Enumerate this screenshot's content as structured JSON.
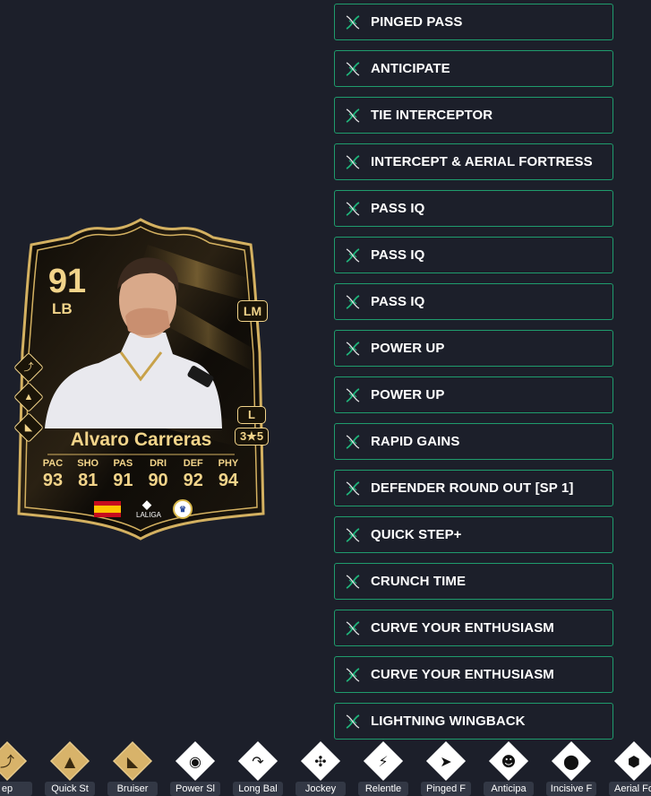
{
  "card": {
    "rating": "91",
    "position": "LB",
    "alt_position": "LM",
    "preferred_foot": "L",
    "skill_weak": "3★5",
    "name": "Alvaro Carreras",
    "stats": [
      {
        "label": "PAC",
        "value": "93"
      },
      {
        "label": "SHO",
        "value": "81"
      },
      {
        "label": "PAS",
        "value": "91"
      },
      {
        "label": "DRI",
        "value": "90"
      },
      {
        "label": "DEF",
        "value": "92"
      },
      {
        "label": "PHY",
        "value": "94"
      }
    ],
    "nation_icon": "spain-flag-icon",
    "league_icon": "laliga-icon",
    "league_label": "LALIGA",
    "club_icon": "real-madrid-crest-icon",
    "colors": {
      "gold": "#f2d48a",
      "card_bg": "#16130d"
    }
  },
  "evolutions": [
    {
      "label": "PINGED PASS"
    },
    {
      "label": "ANTICIPATE"
    },
    {
      "label": "TIE INTERCEPTOR"
    },
    {
      "label": "INTERCEPT & AERIAL FORTRESS"
    },
    {
      "label": "PASS IQ"
    },
    {
      "label": "PASS IQ"
    },
    {
      "label": "PASS IQ"
    },
    {
      "label": "POWER UP"
    },
    {
      "label": "POWER UP"
    },
    {
      "label": "RAPID GAINS"
    },
    {
      "label": "DEFENDER ROUND OUT [SP 1]"
    },
    {
      "label": "QUICK STEP+"
    },
    {
      "label": "CRUNCH TIME"
    },
    {
      "label": "CURVE YOUR ENTHUSIASM"
    },
    {
      "label": "CURVE YOUR ENTHUSIASM"
    },
    {
      "label": "LIGHTNING WINGBACK"
    }
  ],
  "evo_icon": "dna-icon",
  "playstyles": [
    {
      "label": "ep",
      "plus": true,
      "icon": "step-icon"
    },
    {
      "label": "Quick St",
      "plus": true,
      "icon": "rocket-icon"
    },
    {
      "label": "Bruiser",
      "plus": true,
      "icon": "flexed-arm-icon"
    },
    {
      "label": "Power Sl",
      "plus": false,
      "icon": "power-shot-icon"
    },
    {
      "label": "Long Bal",
      "plus": false,
      "icon": "long-ball-icon"
    },
    {
      "label": "Jockey",
      "plus": false,
      "icon": "jockey-icon"
    },
    {
      "label": "Relentle",
      "plus": false,
      "icon": "relentless-icon"
    },
    {
      "label": "Pinged F",
      "plus": false,
      "icon": "pinged-pass-icon"
    },
    {
      "label": "Anticipa",
      "plus": false,
      "icon": "raccoon-icon"
    },
    {
      "label": "Incisive F",
      "plus": false,
      "icon": "location-pin-icon"
    },
    {
      "label": "Aerial Fo",
      "plus": false,
      "icon": "aerial-fortress-icon"
    }
  ],
  "colors": {
    "page_bg": "#1c1f2a",
    "evo_border": "#1f9c6d",
    "gold_plus": "#d8b36a"
  }
}
